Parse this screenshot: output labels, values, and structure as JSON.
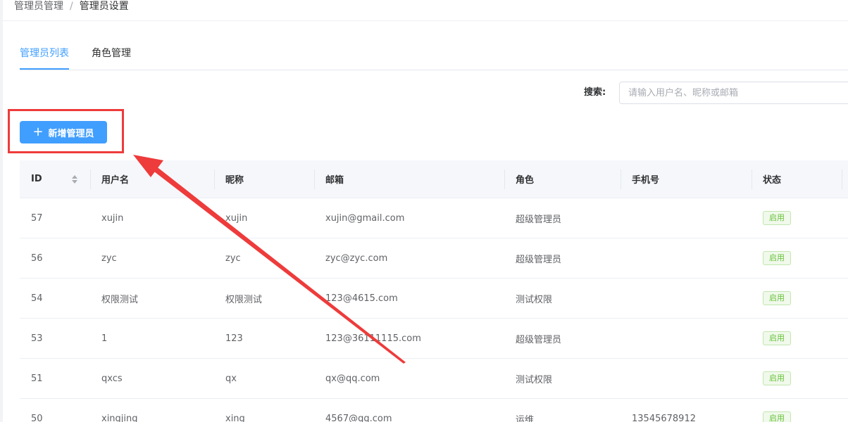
{
  "breadcrumb": {
    "parent": "管理员管理",
    "separator": "/",
    "current": "管理员设置"
  },
  "tabs": [
    {
      "label": "管理员列表",
      "active": true
    },
    {
      "label": "角色管理",
      "active": false
    }
  ],
  "search": {
    "label": "搜索:",
    "placeholder": "请输入用户名、昵称或邮箱"
  },
  "toolbar": {
    "add_label": "新增管理员"
  },
  "table": {
    "columns": [
      "ID",
      "用户名",
      "昵称",
      "邮箱",
      "角色",
      "手机号",
      "状态"
    ],
    "rows": [
      {
        "id": "57",
        "username": "xujin",
        "nickname": "xujin",
        "email": "xujin@gmail.com",
        "role": "超级管理员",
        "phone": "",
        "status": "启用"
      },
      {
        "id": "56",
        "username": "zyc",
        "nickname": "zyc",
        "email": "zyc@zyc.com",
        "role": "超级管理员",
        "phone": "",
        "status": "启用"
      },
      {
        "id": "54",
        "username": "权限测试",
        "nickname": "权限测试",
        "email": "123@4615.com",
        "role": "测试权限",
        "phone": "",
        "status": "启用"
      },
      {
        "id": "53",
        "username": "1",
        "nickname": "123",
        "email": "123@36111115.com",
        "role": "超级管理员",
        "phone": "",
        "status": "启用"
      },
      {
        "id": "51",
        "username": "qxcs",
        "nickname": "qx",
        "email": "qx@qq.com",
        "role": "测试权限",
        "phone": "",
        "status": "启用"
      },
      {
        "id": "50",
        "username": "xingjing",
        "nickname": "xing",
        "email": "4567@qq.com",
        "role": "运维",
        "phone": "13545678912",
        "status": "启用"
      }
    ]
  },
  "colors": {
    "primary": "#409eff",
    "annotation": "#ee3b3b",
    "success": "#67c23a"
  }
}
